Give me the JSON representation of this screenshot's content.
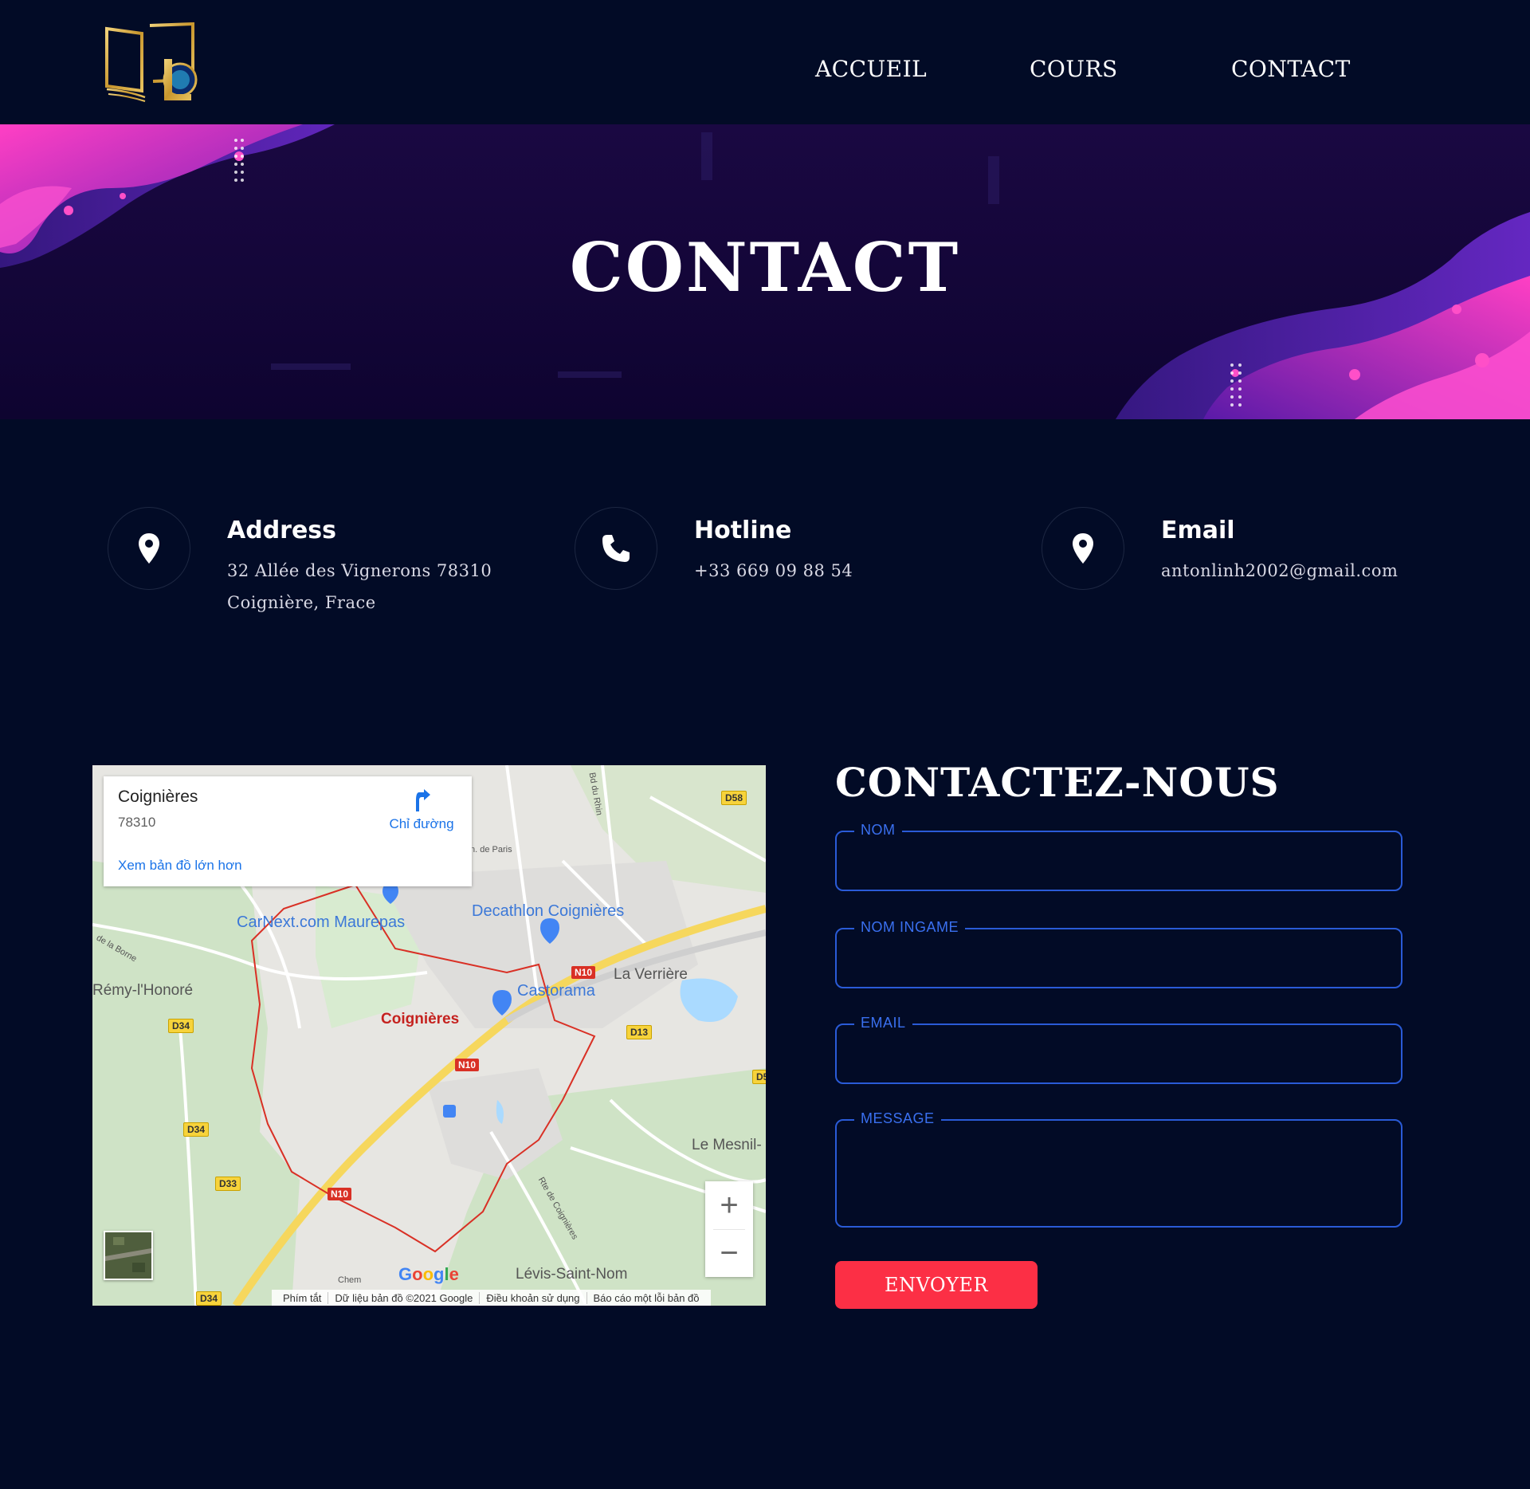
{
  "header": {
    "logo_icon": "book-logo-icon",
    "nav": [
      {
        "label": "ACCUEIL"
      },
      {
        "label": "COURS"
      },
      {
        "label": "CONTACT"
      }
    ]
  },
  "hero": {
    "title": "CONTACT"
  },
  "info": [
    {
      "icon": "location-pin-icon",
      "title": "Address",
      "lines": [
        "32 Allée des Vignerons 78310",
        "Coignière, Frace"
      ]
    },
    {
      "icon": "phone-icon",
      "title": "Hotline",
      "lines": [
        "+33 669 09 88 54"
      ]
    },
    {
      "icon": "location-pin-icon",
      "title": "Email",
      "lines": [
        "antonlinh2002@gmail.com"
      ]
    }
  ],
  "map": {
    "card_title": "Coignières",
    "card_sub": "78310",
    "directions_label": "Chỉ đường",
    "larger_map_link": "Xem bản đồ lớn hơn",
    "places": {
      "carnext": "CarNext.com Maurepas",
      "decathlon": "Decathlon Coignières",
      "castorama": "Castorama",
      "la_verriere": "La Verrière",
      "coignieres": "Coignières",
      "remy": "Rémy-l'Honoré",
      "le_mesnil": "Le Mesnil-",
      "levis": "Lévis-Saint-Nom",
      "bd_du_rhin": "Bd du Rhin",
      "de_paris": "n. de Paris",
      "la_borne": "de la Borne",
      "rte_coignieres": "Rte de Coignières",
      "chem": "Chem"
    },
    "roads": {
      "d58": "D58",
      "n10_a": "N10",
      "n10_b": "N10",
      "n10_c": "N10",
      "d13": "D13",
      "d5": "D5",
      "d34_a": "D34",
      "d34_b": "D34",
      "d34_c": "D34",
      "d33": "D33"
    },
    "zoom_in": "+",
    "zoom_out": "−",
    "google": "Google",
    "attribution": [
      "Phím tắt",
      "Dữ liệu bản đồ ©2021 Google",
      "Điều khoản sử dụng",
      "Báo cáo một lỗi bản đồ"
    ],
    "colors": {
      "road_major": "#f6d75d",
      "border": "#d93025",
      "water": "#aadaff",
      "park": "#c8e6c9"
    }
  },
  "form": {
    "title": "CONTACTEZ-NOUS",
    "fields": {
      "nom": {
        "label": "NOM",
        "value": ""
      },
      "ingame": {
        "label": "NOM INGAME",
        "value": ""
      },
      "email": {
        "label": "EMAIL",
        "value": ""
      },
      "message": {
        "label": "MESSAGE",
        "value": ""
      }
    },
    "submit_label": "ENVOYER"
  },
  "colors": {
    "background": "#020b26",
    "accent_red": "#fc2f45",
    "field_border": "#2a5bd7",
    "gold": "#d4a83a"
  }
}
